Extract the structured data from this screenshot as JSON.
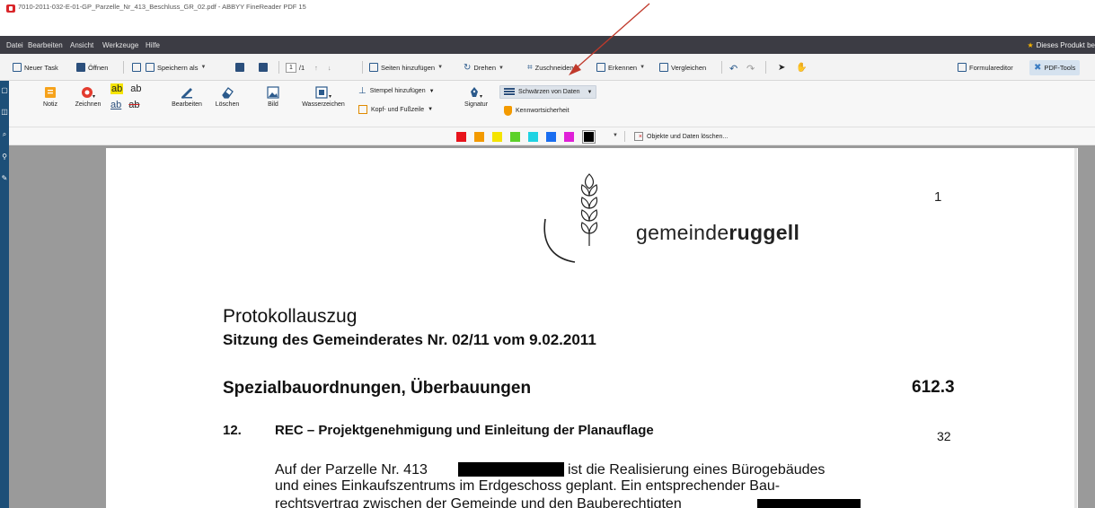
{
  "window": {
    "title": "7010-2011-032-E-01-GP_Parzelle_Nr_413_Beschluss_GR_02.pdf - ABBYY FineReader PDF 15"
  },
  "menu": {
    "items": [
      "Datei",
      "Bearbeiten",
      "Ansicht",
      "Werkzeuge",
      "Hilfe"
    ],
    "promo": "Dieses Produkt be"
  },
  "toolbar": {
    "new_task": "Neuer Task",
    "open": "Öffnen",
    "save_as": "Speichern als",
    "page_current": "1",
    "page_total": "/1",
    "add_pages": "Seiten hinzufügen",
    "rotate": "Drehen",
    "crop": "Zuschneiden",
    "recognize": "Erkennen",
    "compare": "Vergleichen",
    "form_editor": "Formulareditor",
    "pdf_tools": "PDF-Tools"
  },
  "ribbon": {
    "note": "Notiz",
    "draw": "Zeichnen",
    "edit": "Bearbeiten",
    "delete": "Löschen",
    "image": "Bild",
    "watermark": "Wasserzeichen",
    "add_stamp": "Stempel hinzufügen",
    "header_footer": "Kopf- und Fußzeile",
    "signature": "Signatur",
    "redact_data": "Schwärzen von Daten",
    "password_security": "Kennwortsicherheit",
    "ab": "ab"
  },
  "color_row": {
    "colors": [
      "#e8141c",
      "#f39a00",
      "#f5e400",
      "#5cd12a",
      "#1fd3e3",
      "#1a6ef0",
      "#e020d8",
      "#000000"
    ],
    "clear_label": "Objekte und Daten löschen..."
  },
  "document": {
    "logo_prefix": "gemeinde",
    "logo_bold": "ruggell",
    "page_number": "1",
    "heading": "Protokollauszug",
    "session": "Sitzung des Gemeinderates Nr. 02/11 vom 9.02.2011",
    "section": "Spezialbauordnungen, Überbauungen",
    "section_code": "612.3",
    "item_number": "12.",
    "item_title": "REC – Projektgenehmigung und Einleitung der Planauflage",
    "item_page": "32",
    "para_line1_a": "Auf der Parzelle Nr. 413",
    "para_line1_b": "ist die Realisierung eines Bürogebäudes",
    "para_line2": "und eines Einkaufszentrums im Erdgeschoss geplant. Ein entsprechender Bau-",
    "para_line3": "rechtsvertrag zwischen der Gemeinde und den Bauberechtigten"
  }
}
